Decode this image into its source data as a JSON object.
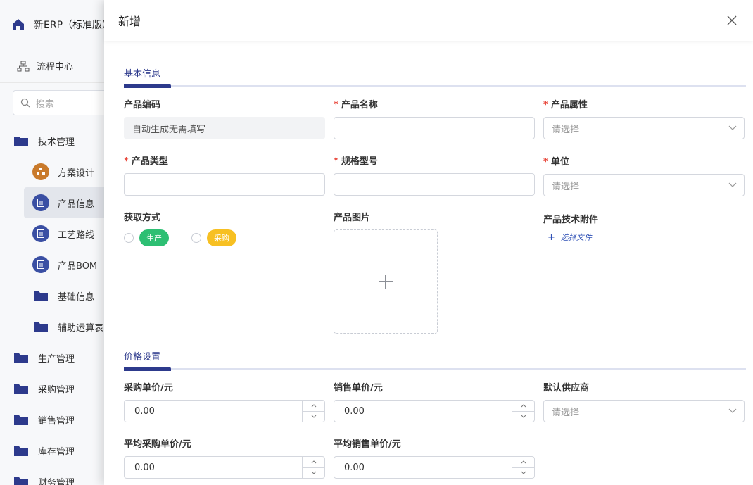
{
  "app": {
    "title": "新ERP（标准版）"
  },
  "sidebar": {
    "flow_label": "流程中心",
    "search_placeholder": "搜索",
    "tech": {
      "label": "技术管理",
      "children": [
        {
          "label": "方案设计",
          "icon": "org-chart-icon"
        },
        {
          "label": "产品信息",
          "icon": "document-icon"
        },
        {
          "label": "工艺路线",
          "icon": "document-icon"
        },
        {
          "label": "产品BOM",
          "icon": "document-icon"
        },
        {
          "label": "基础信息",
          "icon": "folder-icon"
        },
        {
          "label": "辅助运算表",
          "icon": "folder-icon"
        }
      ]
    },
    "modules": [
      {
        "label": "生产管理"
      },
      {
        "label": "采购管理"
      },
      {
        "label": "销售管理"
      },
      {
        "label": "库存管理"
      },
      {
        "label": "财务管理"
      }
    ]
  },
  "drawer": {
    "title": "新增",
    "basic": {
      "section_title": "基本信息",
      "code": {
        "label": "产品编码",
        "value": "自动生成无需填写"
      },
      "name": {
        "label": "产品名称",
        "value": ""
      },
      "attr": {
        "label": "产品属性",
        "placeholder": "请选择"
      },
      "type": {
        "label": "产品类型",
        "value": ""
      },
      "spec": {
        "label": "规格型号",
        "value": ""
      },
      "unit": {
        "label": "单位",
        "placeholder": "请选择"
      },
      "acquire": {
        "label": "获取方式",
        "options": [
          "生产",
          "采购"
        ]
      },
      "image": {
        "label": "产品图片"
      },
      "attachment": {
        "label": "产品技术附件",
        "link": "选择文件"
      }
    },
    "price": {
      "section_title": "价格设置",
      "purchase": {
        "label": "采购单价/元",
        "value": "0.00"
      },
      "sale": {
        "label": "销售单价/元",
        "value": "0.00"
      },
      "supplier": {
        "label": "默认供应商",
        "placeholder": "请选择"
      },
      "avg_purchase": {
        "label": "平均采购单价/元",
        "value": "0.00"
      },
      "avg_sale": {
        "label": "平均销售单价/元",
        "value": "0.00"
      }
    }
  },
  "colors": {
    "accent": "#2d3a8c",
    "required": "#e8473b",
    "tag_green": "#2dbf73",
    "tag_yellow": "#f7c022"
  }
}
